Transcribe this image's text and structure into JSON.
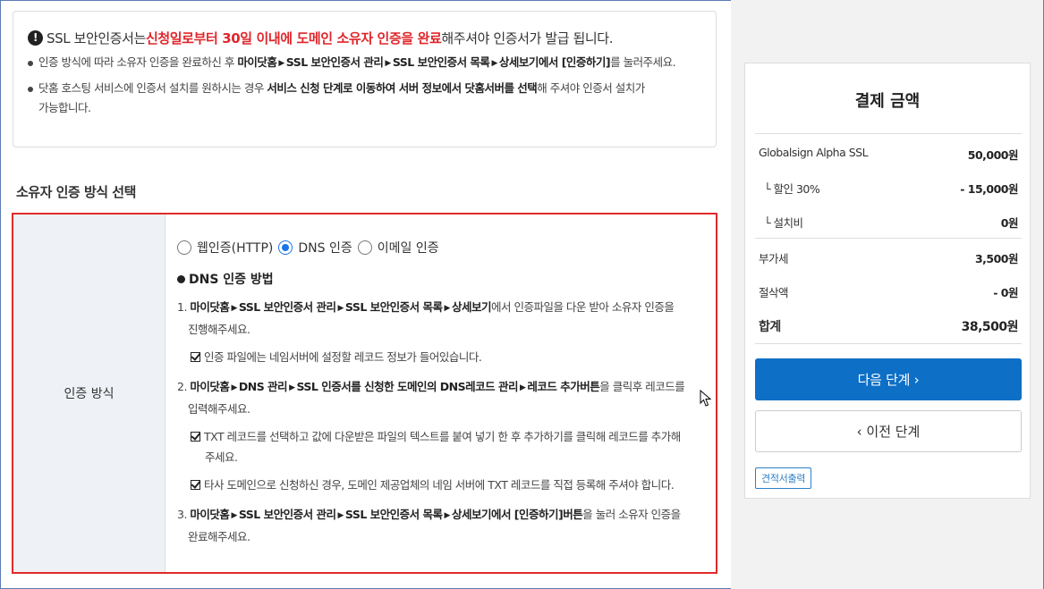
{
  "notice": {
    "head_pre": "SSL 보안인증서는 ",
    "head_red": "신청일로부터 30일 이내에 도메인 소유자 인증을 완료",
    "head_post": "해주셔야 인증서가 발급 됩니다.",
    "item1": {
      "pre": "인증 방식에 따라 소유자 인증을 완료하신 후 ",
      "p1": "마이닷홈",
      "p2": "SSL 보안인증서 관리",
      "p3": "SSL 보안인증서 목록",
      "p4": "상세보기에서 [인증하기]",
      "post": "를 눌러주세요."
    },
    "item2": {
      "pre": "닷홈 호스팅 서비스에 인증서 설치를 원하시는 경우 ",
      "bold": "서비스 신청 단계로 이동하여 서버 정보에서 닷홈서버를 선택",
      "post": "해 주셔야 인증서 설치가",
      "line2": "가능합니다."
    }
  },
  "section_title": "소유자 인증 방식 선택",
  "auth": {
    "label": "인증 방식",
    "radios": [
      "웹인증(HTTP)",
      "DNS 인증",
      "이메일 인증"
    ],
    "selected_index": 1,
    "method_title": "DNS 인증 방법",
    "step1": {
      "num": "1.",
      "p1": "마이닷홈",
      "p2": "SSL 보안인증서 관리",
      "p3": "SSL 보안인증서 목록",
      "p4": "상세보기",
      "post": "에서 인증파일을 다운 받아 소유자 인증을",
      "line2": "진행해주세요."
    },
    "check1": "인증 파일에는 네임서버에 설정할 레코드 정보가 들어있습니다.",
    "step2": {
      "num": "2.",
      "p1": "마이닷홈",
      "p2": "DNS 관리",
      "p3": "SSL 인증서를 신청한 도메인의 DNS레코드 관리",
      "p4": "레코드 추가버튼",
      "post": "을 클릭후 레코드를",
      "line2": "입력해주세요."
    },
    "check2": {
      "line1": "TXT 레코드를 선택하고 값에 다운받은 파일의 텍스트를 붙여 넣기 한 후 추가하기를 클릭해 레코드를 추가해",
      "line2": "주세요."
    },
    "check3": "타사 도메인으로 신청하신 경우, 도메인 제공업체의 네임 서버에 TXT 레코드를 직접 등록해 주셔야 합니다.",
    "step3": {
      "num": "3.",
      "p1": "마이닷홈",
      "p2": "SSL 보안인증서 관리",
      "p3": "SSL 보안인증서 목록",
      "p4": "상세보기에서 [인증하기]버튼",
      "post": "을 눌러 소유자 인증을",
      "line2": "완료해주세요."
    }
  },
  "payment": {
    "title": "결제 금액",
    "product_name": "Globalsign Alpha SSL",
    "product_price": "50,000원",
    "discount_label": "└ 할인 30%",
    "discount_value": "- 15,000원",
    "install_label": "└ 설치비",
    "install_value": "0원",
    "vat_label": "부가세",
    "vat_value": "3,500원",
    "cut_label": "절삭액",
    "cut_value": "- 0원",
    "total_label": "합계",
    "total_value": "38,500원",
    "next_button": "다음 단계 ›",
    "prev_button": "‹ 이전 단계",
    "quote_button": "견적서출력"
  },
  "colors": {
    "accent": "#0d6fc6",
    "alert": "#e0262b",
    "panel_bg": "#f2f2f2"
  }
}
